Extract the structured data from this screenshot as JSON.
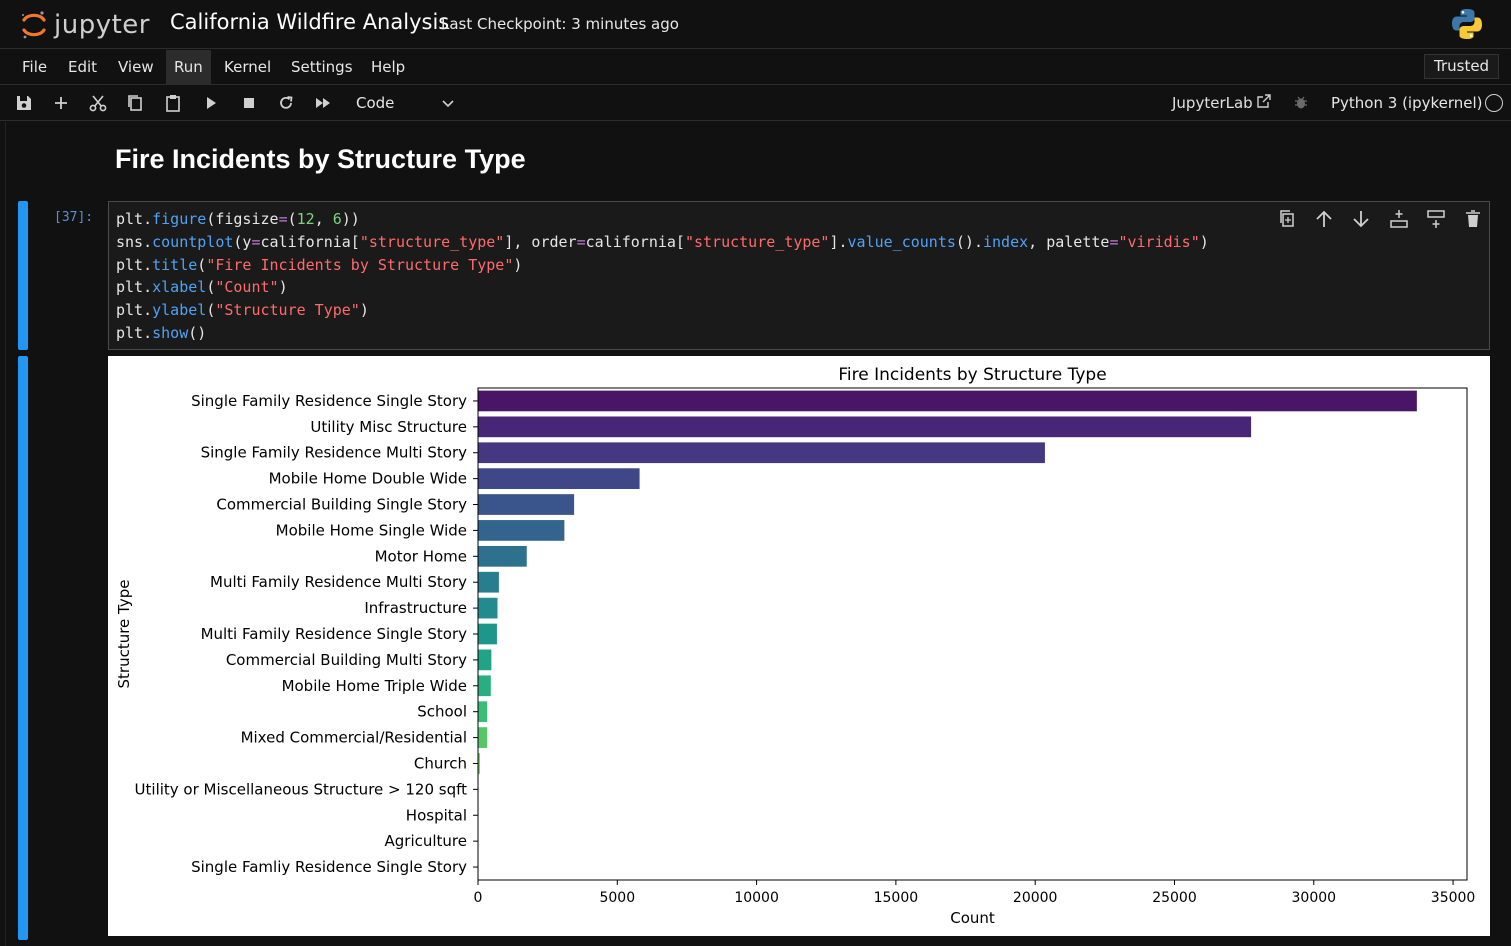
{
  "header": {
    "logo_text": "jupyter",
    "notebook_title": "California Wildfire Analysis",
    "checkpoint": "Last Checkpoint: 3 minutes ago"
  },
  "menu": {
    "items": [
      "File",
      "Edit",
      "View",
      "Run",
      "Kernel",
      "Settings",
      "Help"
    ],
    "active": "Run",
    "trusted_label": "Trusted"
  },
  "toolbar": {
    "cell_type": "Code",
    "jupyterlab_label": "JupyterLab",
    "kernel_name": "Python 3 (ipykernel)"
  },
  "notebook": {
    "markdown_heading": "Fire Incidents by Structure Type",
    "cell_prompt": "[37]:"
  },
  "colors": {
    "accent": "#2196f3",
    "background": "#111111"
  },
  "chart_data": {
    "type": "bar",
    "orientation": "horizontal",
    "title": "Fire Incidents by Structure Type",
    "xlabel": "Count",
    "ylabel": "Structure Type",
    "xlim": [
      0,
      35500
    ],
    "xticks": [
      0,
      5000,
      10000,
      15000,
      20000,
      25000,
      30000,
      35000
    ],
    "palette": "viridis",
    "grid": false,
    "categories": [
      "Single Family Residence Single Story",
      "Utility Misc Structure",
      "Single Family Residence Multi Story",
      "Mobile Home Double Wide",
      "Commercial Building Single Story",
      "Mobile Home Single Wide",
      "Motor Home",
      "Multi Family Residence Multi Story",
      "Infrastructure",
      "Multi Family Residence Single Story",
      "Commercial Building Multi Story",
      "Mobile Home Triple Wide",
      "School",
      "Mixed Commercial/Residential",
      "Church",
      "Utility or Miscellaneous Structure > 120 sqft",
      "Hospital",
      "Agriculture",
      "Single Famliy Residence Single Story"
    ],
    "values": [
      33700,
      27750,
      20350,
      5800,
      3450,
      3100,
      1750,
      750,
      700,
      680,
      480,
      460,
      330,
      330,
      70,
      5,
      3,
      2,
      1
    ],
    "bar_colors": [
      "#481567",
      "#482677",
      "#453781",
      "#3f4788",
      "#39558c",
      "#32648e",
      "#2d718e",
      "#287d8e",
      "#238a8d",
      "#1f968b",
      "#20a386",
      "#29af7f",
      "#3cbc75",
      "#56c667",
      "#75d054",
      "#95d840",
      "#b8de29",
      "#dae319",
      "#fde725"
    ]
  }
}
